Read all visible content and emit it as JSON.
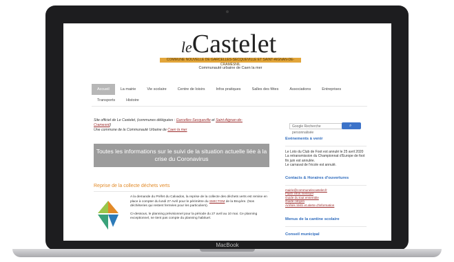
{
  "device": {
    "brand": "MacBook"
  },
  "site": {
    "logo_le": "le",
    "logo_name": "Castelet",
    "tagline": "COMMUNE NOUVELLE DE GARCELLES-SECQUEVILLE ET SAINT-AIGNAN-DE-CRAMESNIL",
    "subtag": "Communauté urbaine de Caen la mer",
    "nav": [
      "Accueil",
      "La mairie",
      "Vie scolaire",
      "Centre de loisirs",
      "Infos pratiques",
      "Salles des fêtes",
      "Associations",
      "Entreprises",
      "Transports",
      "Histoire"
    ],
    "intro_1": "Site officiel de Le Castelet, (communes déléguées : ",
    "intro_link_1": "Garcelles-Secqueville",
    "intro_mid": " et ",
    "intro_link_2": "Saint-Aignan-de-Cramesnil",
    "intro_2": "Une commune de la Communauté Urbaine de ",
    "intro_link_3": "Caen la mer",
    "covid_banner": "Toutes les informations sur le suivi de la situation actuelle liée à la crise du Coronavirus",
    "article": {
      "title": "Reprise de la collecte déchets verts",
      "p1_a": "A la demande du Préfet du Calvados, la reprise de la collecte des déchets verts est remise en place à compter du lundi 27 Avril pour le périmètre du ",
      "p1_link": "SMICTOM",
      "p1_b": " de la Bruyère. (Nos déchèteries qui restent fermées pour les particuliers).",
      "p2": "Ci-dessous, le planning prévisionnel pour la période du 27 avril au 10 mai. Ce planning exceptionnel, ne tient pas compte du planning habituel."
    },
    "search": {
      "placeholder": "Google Recherche personnalisée"
    },
    "sidebar": {
      "events_title": "Evénements à venir",
      "events_lines": [
        "Le Loto du Club de Foot est annulé le 25 avril 2020",
        "La retransmission du Championnat d'Europe de foot fin juin est annulée.",
        "Le carnaval de l'école est annulé."
      ],
      "contacts_title": "Contacts & Horaires d'ouvertures",
      "contacts_links": [
        "mairie@communelecastelet.fr",
        "Flash infos mensuel",
        "Guide du tout ensemble",
        "Guide citoyen",
        "Arrêtés SMS et alerte d'information"
      ],
      "cantine_title": "Menus de la cantine scolaire",
      "conseil_title": "Conseil municipal"
    }
  },
  "colors": {
    "accent": "#e28a28",
    "link": "#2e6bbd",
    "banner": "#9c9c9c",
    "tag": "#e2a53a"
  }
}
